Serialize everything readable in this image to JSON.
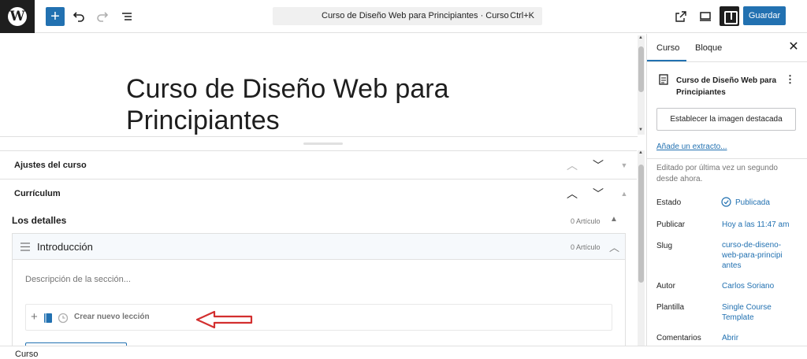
{
  "topbar": {
    "command_title": "Curso de Diseño Web para Principiantes · Curso",
    "command_shortcut": "Ctrl+K",
    "save_label": "Guardar"
  },
  "post": {
    "title": "Curso de Diseño Web para Principiantes"
  },
  "metaboxes": {
    "course_settings": "Ajustes del curso",
    "curriculum": "Currículum"
  },
  "curriculum": {
    "details_label": "Los detalles",
    "details_count": "0 Artículo",
    "section": {
      "title": "Introducción",
      "count": "0 Artículo",
      "description_placeholder": "Descripción de la sección...",
      "new_lesson_label": "Crear nuevo lección"
    }
  },
  "footer": {
    "breadcrumb": "Curso"
  },
  "sidebar": {
    "tabs": [
      "Curso",
      "Bloque"
    ],
    "post_title": "Curso de Diseño Web para Principiantes",
    "featured_image_button": "Establecer la imagen destacada",
    "excerpt_link": "Añade un extracto...",
    "last_edited": "Editado por última vez un segundo desde ahora.",
    "rows": [
      {
        "label": "Estado",
        "value": "Publicada"
      },
      {
        "label": "Publicar",
        "value": "Hoy a las 11:47 am"
      },
      {
        "label": "Slug",
        "value": "curso-de-diseno-web-para-principiantes"
      },
      {
        "label": "Autor",
        "value": "Carlos Soriano"
      },
      {
        "label": "Plantilla",
        "value": "Single Course Template"
      },
      {
        "label": "Comentarios",
        "value": "Abrir"
      }
    ]
  },
  "colors": {
    "accent": "#2271b1",
    "annotation_arrow": "#d32f2f"
  }
}
